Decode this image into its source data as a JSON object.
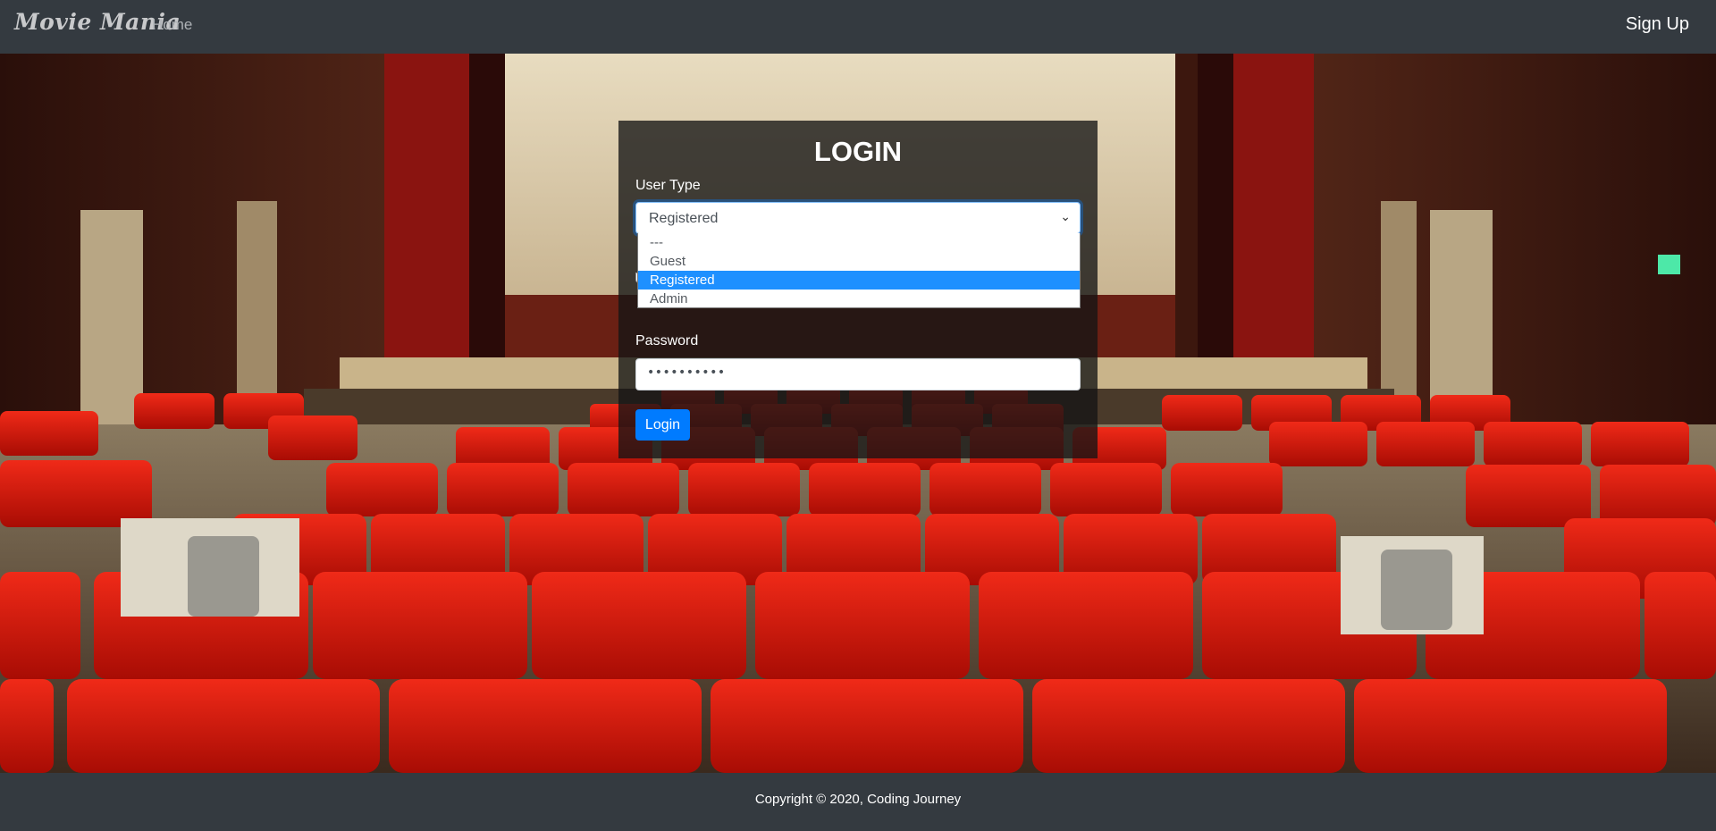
{
  "navbar": {
    "brand": "Movie Mania",
    "home_label": "Home",
    "signup_label": "Sign Up"
  },
  "login": {
    "title": "LOGIN",
    "user_type_label": "User Type",
    "user_type_value": "Registered",
    "user_type_options": [
      "---",
      "Guest",
      "Registered",
      "Admin"
    ],
    "password_label": "Password",
    "password_value": "••••••••••",
    "login_button": "Login"
  },
  "footer": {
    "copyright": "Copyright © 2020, Coding Journey"
  },
  "colors": {
    "navbar_bg": "#343a40",
    "primary": "#007bff",
    "option_highlight": "#1e90ff",
    "seat_red": "#d8180c"
  },
  "icons": {
    "select_arrow": "chevron-down-icon"
  }
}
